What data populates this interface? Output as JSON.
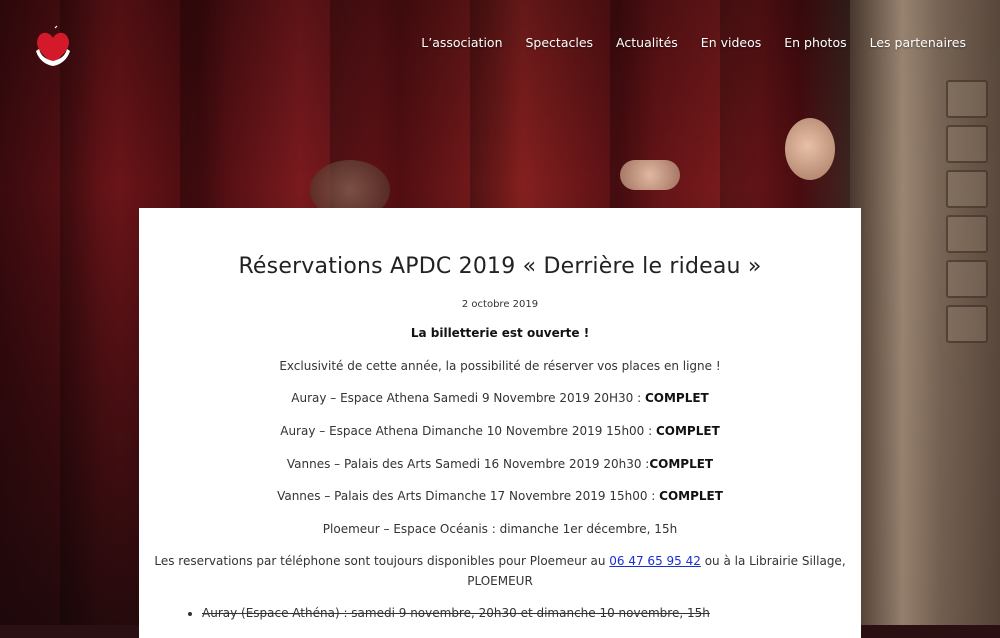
{
  "nav": {
    "items": [
      "L’association",
      "Spectacles",
      "Actualités",
      "En videos",
      "En photos",
      "Les partenaires"
    ]
  },
  "logo": {
    "icon": "heart-hands-logo",
    "color": "#d41a2a"
  },
  "article": {
    "title": "Réservations APDC 2019 « Derrière le rideau »",
    "date": "2 octobre 2019",
    "intro": "La billetterie est ouverte !",
    "exclusive": "Exclusivité de cette année, la possibilité de réserver vos places en ligne !",
    "sessions": [
      {
        "text": "Auray – Espace Athena Samedi 9 Novembre 2019 20H30 : ",
        "status": "COMPLET"
      },
      {
        "text": "Auray – Espace Athena Dimanche 10 Novembre 2019 15h00 : ",
        "status": "COMPLET"
      },
      {
        "text": "Vannes – Palais des Arts Samedi 16 Novembre 2019 20h30 :",
        "status": "COMPLET"
      },
      {
        "text": "Vannes – Palais des Arts Dimanche 17 Novembre 2019 15h00 : ",
        "status": "COMPLET"
      },
      {
        "text": "Ploemeur – Espace Océanis : dimanche 1er décembre, 15h",
        "status": ""
      }
    ],
    "phone_text_before": "Les reservations par téléphone sont toujours disponibles pour Ploemeur au ",
    "phone_number": "06 47 65 95 42",
    "phone_text_after": " ou à la Librairie Sillage,",
    "phone_text_line2": "PLOEMEUR",
    "list_items": [
      "Auray (Espace Athéna) : samedi 9 novembre, 20h30 et dimanche 10 novembre, 15h"
    ]
  },
  "colors": {
    "link": "#1a2fd4",
    "curtain": "#7a1a1e"
  }
}
